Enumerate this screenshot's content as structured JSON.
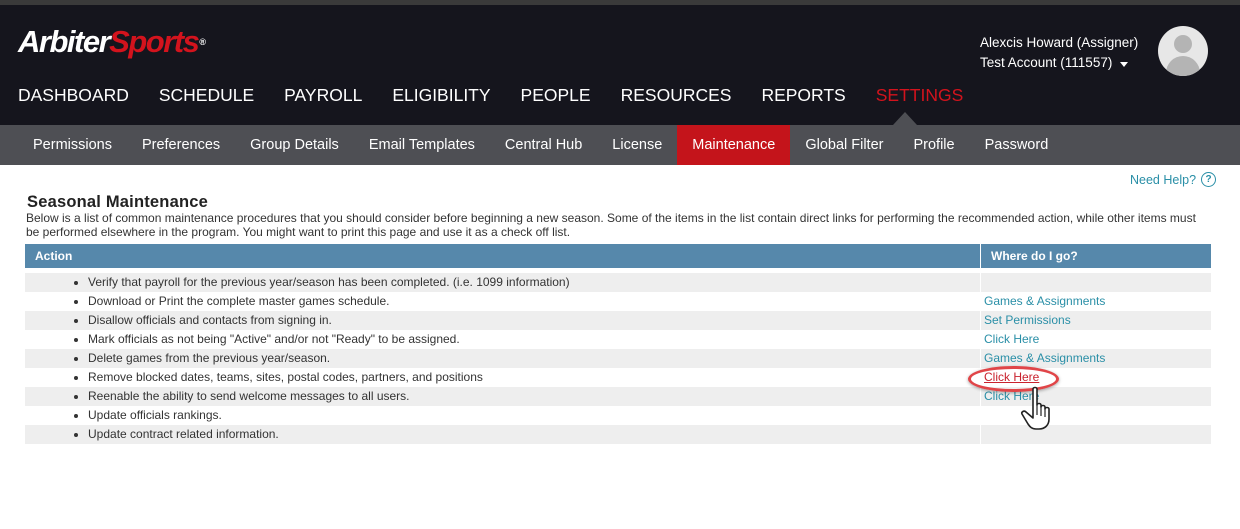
{
  "header": {
    "logo_part1": "Arbiter",
    "logo_part2": "Sports",
    "user_name": "Alexcis Howard (Assigner)",
    "account": "Test Account (111557)"
  },
  "main_nav": {
    "items": [
      "DASHBOARD",
      "SCHEDULE",
      "PAYROLL",
      "ELIGIBILITY",
      "PEOPLE",
      "RESOURCES",
      "REPORTS",
      "SETTINGS"
    ],
    "active": "SETTINGS"
  },
  "sub_nav": {
    "items": [
      "Permissions",
      "Preferences",
      "Group Details",
      "Email Templates",
      "Central Hub",
      "License",
      "Maintenance",
      "Global Filter",
      "Profile",
      "Password"
    ],
    "active": "Maintenance"
  },
  "help_link": "Need Help?",
  "page": {
    "title": "Seasonal Maintenance",
    "description": "Below is a list of common maintenance procedures that you should consider before beginning a new season. Some of the items in the list contain direct links for performing the recommended action, while other items must be performed elsewhere in the program. You might want to print this page and use it as a check off list."
  },
  "table": {
    "headers": [
      "Action",
      "Where do I go?"
    ],
    "rows": [
      {
        "action": "Verify that payroll for the previous year/season has been completed. (i.e. 1099 information)",
        "link": ""
      },
      {
        "action": "Download or Print the complete master games schedule.",
        "link": "Games & Assignments"
      },
      {
        "action": "Disallow officials and contacts from signing in.",
        "link": "Set Permissions"
      },
      {
        "action": "Mark officials as not being \"Active\" and/or not \"Ready\" to be assigned.",
        "link": "Click Here"
      },
      {
        "action": "Delete games from the previous year/season.",
        "link": "Games & Assignments"
      },
      {
        "action": "Remove blocked dates, teams, sites, postal codes, partners, and positions",
        "link": "Click Here"
      },
      {
        "action": "Reenable the ability to send welcome messages to all users.",
        "link": "Click Here"
      },
      {
        "action": "Update officials rankings.",
        "link": ""
      },
      {
        "action": "Update contract related information.",
        "link": ""
      }
    ]
  },
  "colors": {
    "header_bg": "#15151d",
    "subnav_bg": "#4e4f54",
    "accent_red": "#d3131d",
    "table_header": "#5688ab",
    "link": "#2a8fa7"
  }
}
